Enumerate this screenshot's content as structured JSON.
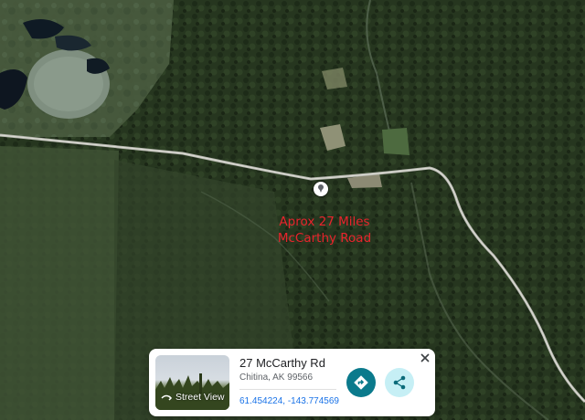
{
  "map": {
    "type": "satellite",
    "annotation_lines": [
      "Aprox 27 Miles",
      "McCarthy Road"
    ],
    "annotation_color": "#e8242c"
  },
  "place_card": {
    "title": "27 McCarthy Rd",
    "subtitle": "Chitina, AK 99566",
    "coordinates": "61.454224, -143.774569",
    "street_view_label": "Street View",
    "directions_icon": "directions-icon",
    "share_icon": "share-icon",
    "close_icon": "close-icon",
    "accent_color": "#0b7a8c"
  }
}
